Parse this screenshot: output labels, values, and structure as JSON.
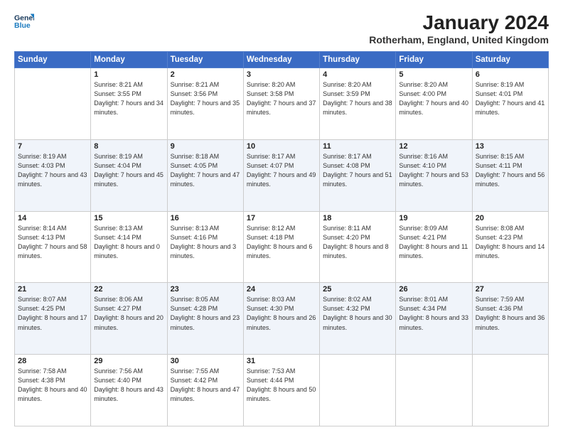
{
  "header": {
    "logo_line1": "General",
    "logo_line2": "Blue",
    "title": "January 2024",
    "subtitle": "Rotherham, England, United Kingdom"
  },
  "days": [
    "Sunday",
    "Monday",
    "Tuesday",
    "Wednesday",
    "Thursday",
    "Friday",
    "Saturday"
  ],
  "weeks": [
    [
      {
        "date": "",
        "sunrise": "",
        "sunset": "",
        "daylight": ""
      },
      {
        "date": "1",
        "sunrise": "Sunrise: 8:21 AM",
        "sunset": "Sunset: 3:55 PM",
        "daylight": "Daylight: 7 hours and 34 minutes."
      },
      {
        "date": "2",
        "sunrise": "Sunrise: 8:21 AM",
        "sunset": "Sunset: 3:56 PM",
        "daylight": "Daylight: 7 hours and 35 minutes."
      },
      {
        "date": "3",
        "sunrise": "Sunrise: 8:20 AM",
        "sunset": "Sunset: 3:58 PM",
        "daylight": "Daylight: 7 hours and 37 minutes."
      },
      {
        "date": "4",
        "sunrise": "Sunrise: 8:20 AM",
        "sunset": "Sunset: 3:59 PM",
        "daylight": "Daylight: 7 hours and 38 minutes."
      },
      {
        "date": "5",
        "sunrise": "Sunrise: 8:20 AM",
        "sunset": "Sunset: 4:00 PM",
        "daylight": "Daylight: 7 hours and 40 minutes."
      },
      {
        "date": "6",
        "sunrise": "Sunrise: 8:19 AM",
        "sunset": "Sunset: 4:01 PM",
        "daylight": "Daylight: 7 hours and 41 minutes."
      }
    ],
    [
      {
        "date": "7",
        "sunrise": "Sunrise: 8:19 AM",
        "sunset": "Sunset: 4:03 PM",
        "daylight": "Daylight: 7 hours and 43 minutes."
      },
      {
        "date": "8",
        "sunrise": "Sunrise: 8:19 AM",
        "sunset": "Sunset: 4:04 PM",
        "daylight": "Daylight: 7 hours and 45 minutes."
      },
      {
        "date": "9",
        "sunrise": "Sunrise: 8:18 AM",
        "sunset": "Sunset: 4:05 PM",
        "daylight": "Daylight: 7 hours and 47 minutes."
      },
      {
        "date": "10",
        "sunrise": "Sunrise: 8:17 AM",
        "sunset": "Sunset: 4:07 PM",
        "daylight": "Daylight: 7 hours and 49 minutes."
      },
      {
        "date": "11",
        "sunrise": "Sunrise: 8:17 AM",
        "sunset": "Sunset: 4:08 PM",
        "daylight": "Daylight: 7 hours and 51 minutes."
      },
      {
        "date": "12",
        "sunrise": "Sunrise: 8:16 AM",
        "sunset": "Sunset: 4:10 PM",
        "daylight": "Daylight: 7 hours and 53 minutes."
      },
      {
        "date": "13",
        "sunrise": "Sunrise: 8:15 AM",
        "sunset": "Sunset: 4:11 PM",
        "daylight": "Daylight: 7 hours and 56 minutes."
      }
    ],
    [
      {
        "date": "14",
        "sunrise": "Sunrise: 8:14 AM",
        "sunset": "Sunset: 4:13 PM",
        "daylight": "Daylight: 7 hours and 58 minutes."
      },
      {
        "date": "15",
        "sunrise": "Sunrise: 8:13 AM",
        "sunset": "Sunset: 4:14 PM",
        "daylight": "Daylight: 8 hours and 0 minutes."
      },
      {
        "date": "16",
        "sunrise": "Sunrise: 8:13 AM",
        "sunset": "Sunset: 4:16 PM",
        "daylight": "Daylight: 8 hours and 3 minutes."
      },
      {
        "date": "17",
        "sunrise": "Sunrise: 8:12 AM",
        "sunset": "Sunset: 4:18 PM",
        "daylight": "Daylight: 8 hours and 6 minutes."
      },
      {
        "date": "18",
        "sunrise": "Sunrise: 8:11 AM",
        "sunset": "Sunset: 4:20 PM",
        "daylight": "Daylight: 8 hours and 8 minutes."
      },
      {
        "date": "19",
        "sunrise": "Sunrise: 8:09 AM",
        "sunset": "Sunset: 4:21 PM",
        "daylight": "Daylight: 8 hours and 11 minutes."
      },
      {
        "date": "20",
        "sunrise": "Sunrise: 8:08 AM",
        "sunset": "Sunset: 4:23 PM",
        "daylight": "Daylight: 8 hours and 14 minutes."
      }
    ],
    [
      {
        "date": "21",
        "sunrise": "Sunrise: 8:07 AM",
        "sunset": "Sunset: 4:25 PM",
        "daylight": "Daylight: 8 hours and 17 minutes."
      },
      {
        "date": "22",
        "sunrise": "Sunrise: 8:06 AM",
        "sunset": "Sunset: 4:27 PM",
        "daylight": "Daylight: 8 hours and 20 minutes."
      },
      {
        "date": "23",
        "sunrise": "Sunrise: 8:05 AM",
        "sunset": "Sunset: 4:28 PM",
        "daylight": "Daylight: 8 hours and 23 minutes."
      },
      {
        "date": "24",
        "sunrise": "Sunrise: 8:03 AM",
        "sunset": "Sunset: 4:30 PM",
        "daylight": "Daylight: 8 hours and 26 minutes."
      },
      {
        "date": "25",
        "sunrise": "Sunrise: 8:02 AM",
        "sunset": "Sunset: 4:32 PM",
        "daylight": "Daylight: 8 hours and 30 minutes."
      },
      {
        "date": "26",
        "sunrise": "Sunrise: 8:01 AM",
        "sunset": "Sunset: 4:34 PM",
        "daylight": "Daylight: 8 hours and 33 minutes."
      },
      {
        "date": "27",
        "sunrise": "Sunrise: 7:59 AM",
        "sunset": "Sunset: 4:36 PM",
        "daylight": "Daylight: 8 hours and 36 minutes."
      }
    ],
    [
      {
        "date": "28",
        "sunrise": "Sunrise: 7:58 AM",
        "sunset": "Sunset: 4:38 PM",
        "daylight": "Daylight: 8 hours and 40 minutes."
      },
      {
        "date": "29",
        "sunrise": "Sunrise: 7:56 AM",
        "sunset": "Sunset: 4:40 PM",
        "daylight": "Daylight: 8 hours and 43 minutes."
      },
      {
        "date": "30",
        "sunrise": "Sunrise: 7:55 AM",
        "sunset": "Sunset: 4:42 PM",
        "daylight": "Daylight: 8 hours and 47 minutes."
      },
      {
        "date": "31",
        "sunrise": "Sunrise: 7:53 AM",
        "sunset": "Sunset: 4:44 PM",
        "daylight": "Daylight: 8 hours and 50 minutes."
      },
      {
        "date": "",
        "sunrise": "",
        "sunset": "",
        "daylight": ""
      },
      {
        "date": "",
        "sunrise": "",
        "sunset": "",
        "daylight": ""
      },
      {
        "date": "",
        "sunrise": "",
        "sunset": "",
        "daylight": ""
      }
    ]
  ]
}
